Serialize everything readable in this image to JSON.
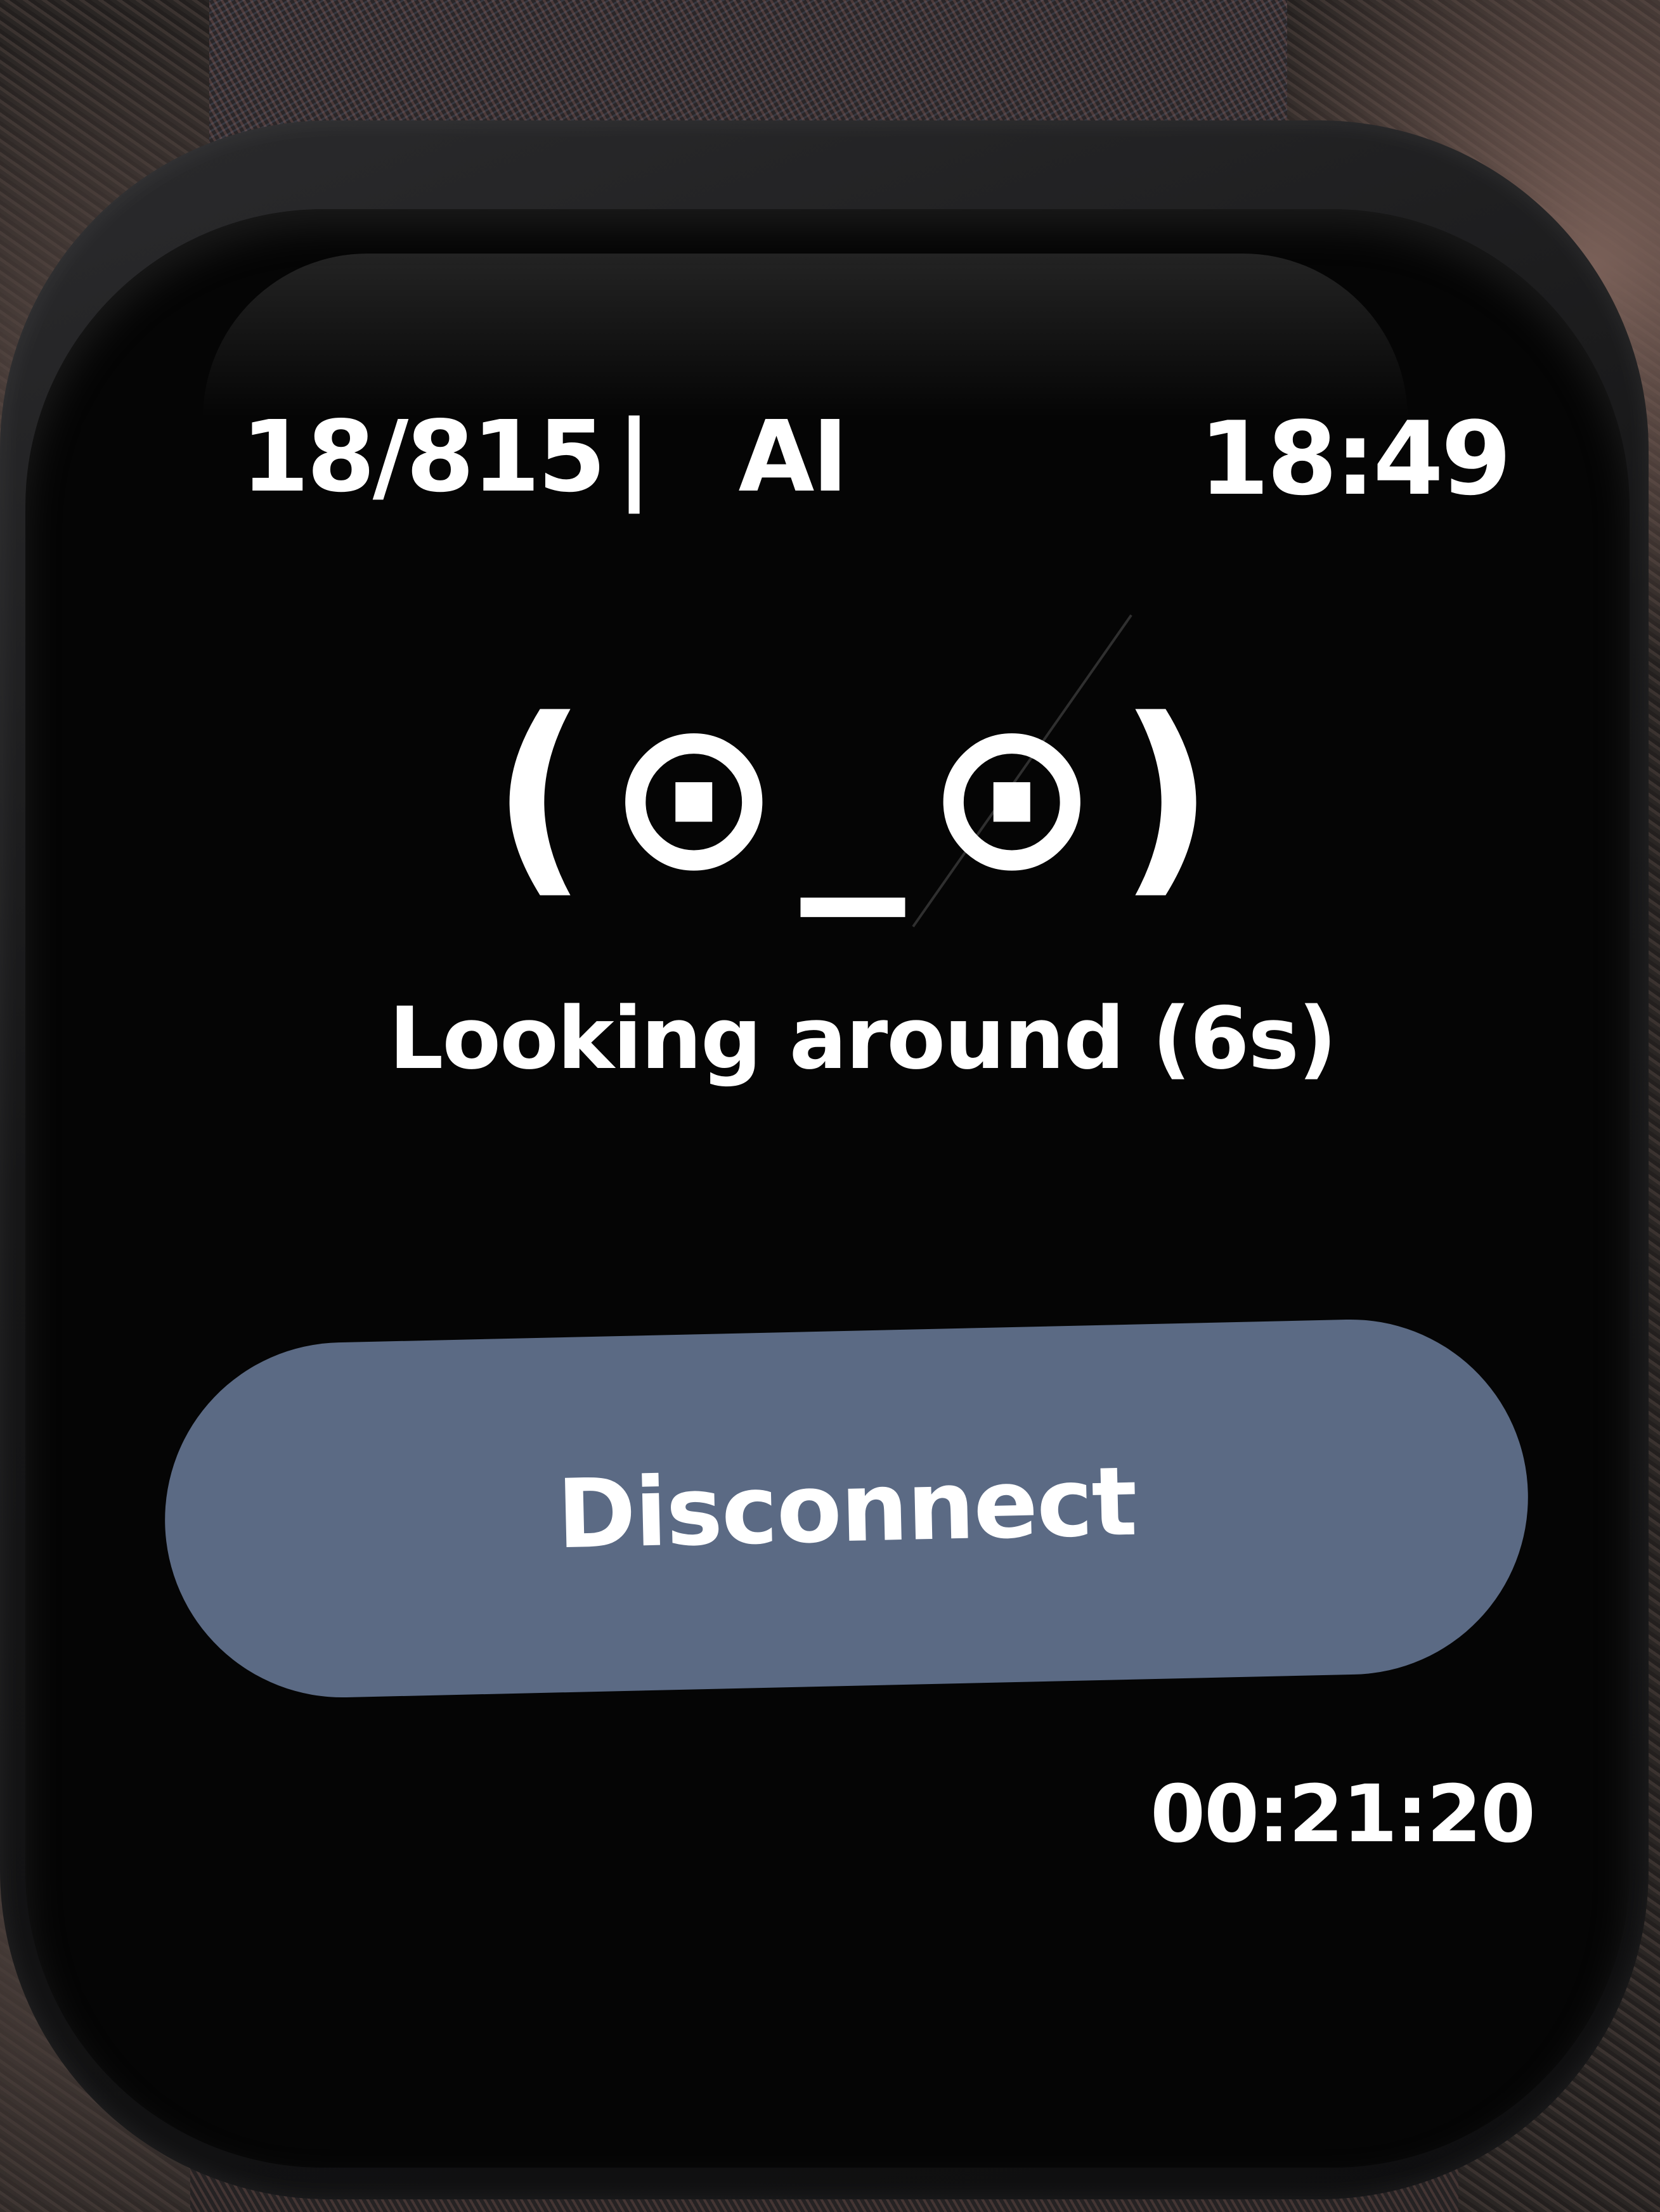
{
  "status_bar": {
    "counter": "18/815",
    "separator": "|",
    "mode": "AI",
    "time": "18:49"
  },
  "face": {
    "expression": "(⊙_⊙)",
    "status": "Looking around (6s)"
  },
  "actions": {
    "disconnect_label": "Disconnect"
  },
  "session": {
    "elapsed": "00:21:20"
  },
  "colors": {
    "screen_background": "#000000",
    "text": "#ffffff",
    "button_fill": "#5b6a84"
  }
}
